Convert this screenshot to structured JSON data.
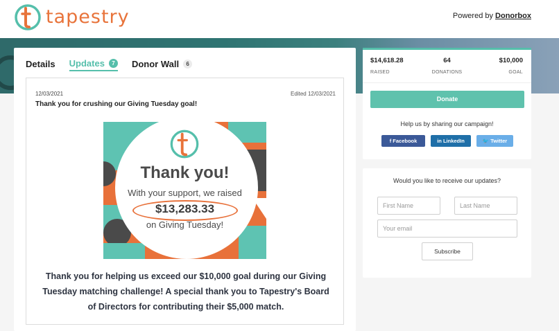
{
  "header": {
    "brand": "tapestry",
    "powered_prefix": "Powered by ",
    "powered_link": "Donorbox",
    "accent": "#e8733a"
  },
  "tabs": [
    {
      "label": "Details",
      "count": ""
    },
    {
      "label": "Updates",
      "count": "7"
    },
    {
      "label": "Donor Wall",
      "count": "6"
    }
  ],
  "update": {
    "date": "12/03/2021",
    "edited": "Edited 12/03/2021",
    "title": "Thank you for crushing our Giving Tuesday goal!",
    "image": {
      "heading": "Thank you!",
      "support": "With your support, we raised",
      "amount": "$13,283.33",
      "on": "on Giving Tuesday!"
    },
    "body": "Thank you for helping us exceed our $10,000 goal during our Giving Tuesday matching challenge! A special thank you to Tapestry's Board of Directors for contributing their $5,000 match."
  },
  "stats": {
    "raised_value": "$14,618.28",
    "raised_label": "RAISED",
    "donations_value": "64",
    "donations_label": "DONATIONS",
    "goal_value": "$10,000",
    "goal_label": "GOAL"
  },
  "donate_label": "Donate",
  "share": {
    "title": "Help us by sharing our campaign!",
    "facebook": "Facebook",
    "linkedin": "LinkedIn",
    "twitter": "Twitter"
  },
  "subscribe": {
    "title": "Would you like to receive our updates?",
    "first_name_placeholder": "First Name",
    "last_name_placeholder": "Last Name",
    "email_placeholder": "Your email",
    "button": "Subscribe"
  },
  "colors": {
    "teal": "#55bfab",
    "orange": "#e8713a",
    "facebook": "#3b5998",
    "linkedin": "#1f6fa8",
    "twitter": "#6aaee8"
  }
}
